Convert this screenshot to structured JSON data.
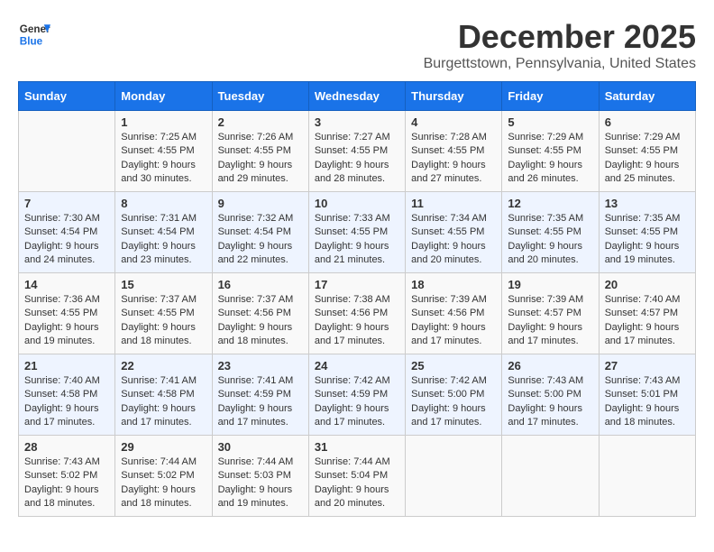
{
  "logo": {
    "line1": "General",
    "line2": "Blue"
  },
  "title": "December 2025",
  "subtitle": "Burgettstown, Pennsylvania, United States",
  "headers": [
    "Sunday",
    "Monday",
    "Tuesday",
    "Wednesday",
    "Thursday",
    "Friday",
    "Saturday"
  ],
  "weeks": [
    [
      {
        "day": "",
        "info": ""
      },
      {
        "day": "1",
        "info": "Sunrise: 7:25 AM\nSunset: 4:55 PM\nDaylight: 9 hours\nand 30 minutes."
      },
      {
        "day": "2",
        "info": "Sunrise: 7:26 AM\nSunset: 4:55 PM\nDaylight: 9 hours\nand 29 minutes."
      },
      {
        "day": "3",
        "info": "Sunrise: 7:27 AM\nSunset: 4:55 PM\nDaylight: 9 hours\nand 28 minutes."
      },
      {
        "day": "4",
        "info": "Sunrise: 7:28 AM\nSunset: 4:55 PM\nDaylight: 9 hours\nand 27 minutes."
      },
      {
        "day": "5",
        "info": "Sunrise: 7:29 AM\nSunset: 4:55 PM\nDaylight: 9 hours\nand 26 minutes."
      },
      {
        "day": "6",
        "info": "Sunrise: 7:29 AM\nSunset: 4:55 PM\nDaylight: 9 hours\nand 25 minutes."
      }
    ],
    [
      {
        "day": "7",
        "info": "Sunrise: 7:30 AM\nSunset: 4:54 PM\nDaylight: 9 hours\nand 24 minutes."
      },
      {
        "day": "8",
        "info": "Sunrise: 7:31 AM\nSunset: 4:54 PM\nDaylight: 9 hours\nand 23 minutes."
      },
      {
        "day": "9",
        "info": "Sunrise: 7:32 AM\nSunset: 4:54 PM\nDaylight: 9 hours\nand 22 minutes."
      },
      {
        "day": "10",
        "info": "Sunrise: 7:33 AM\nSunset: 4:55 PM\nDaylight: 9 hours\nand 21 minutes."
      },
      {
        "day": "11",
        "info": "Sunrise: 7:34 AM\nSunset: 4:55 PM\nDaylight: 9 hours\nand 20 minutes."
      },
      {
        "day": "12",
        "info": "Sunrise: 7:35 AM\nSunset: 4:55 PM\nDaylight: 9 hours\nand 20 minutes."
      },
      {
        "day": "13",
        "info": "Sunrise: 7:35 AM\nSunset: 4:55 PM\nDaylight: 9 hours\nand 19 minutes."
      }
    ],
    [
      {
        "day": "14",
        "info": "Sunrise: 7:36 AM\nSunset: 4:55 PM\nDaylight: 9 hours\nand 19 minutes."
      },
      {
        "day": "15",
        "info": "Sunrise: 7:37 AM\nSunset: 4:55 PM\nDaylight: 9 hours\nand 18 minutes."
      },
      {
        "day": "16",
        "info": "Sunrise: 7:37 AM\nSunset: 4:56 PM\nDaylight: 9 hours\nand 18 minutes."
      },
      {
        "day": "17",
        "info": "Sunrise: 7:38 AM\nSunset: 4:56 PM\nDaylight: 9 hours\nand 17 minutes."
      },
      {
        "day": "18",
        "info": "Sunrise: 7:39 AM\nSunset: 4:56 PM\nDaylight: 9 hours\nand 17 minutes."
      },
      {
        "day": "19",
        "info": "Sunrise: 7:39 AM\nSunset: 4:57 PM\nDaylight: 9 hours\nand 17 minutes."
      },
      {
        "day": "20",
        "info": "Sunrise: 7:40 AM\nSunset: 4:57 PM\nDaylight: 9 hours\nand 17 minutes."
      }
    ],
    [
      {
        "day": "21",
        "info": "Sunrise: 7:40 AM\nSunset: 4:58 PM\nDaylight: 9 hours\nand 17 minutes."
      },
      {
        "day": "22",
        "info": "Sunrise: 7:41 AM\nSunset: 4:58 PM\nDaylight: 9 hours\nand 17 minutes."
      },
      {
        "day": "23",
        "info": "Sunrise: 7:41 AM\nSunset: 4:59 PM\nDaylight: 9 hours\nand 17 minutes."
      },
      {
        "day": "24",
        "info": "Sunrise: 7:42 AM\nSunset: 4:59 PM\nDaylight: 9 hours\nand 17 minutes."
      },
      {
        "day": "25",
        "info": "Sunrise: 7:42 AM\nSunset: 5:00 PM\nDaylight: 9 hours\nand 17 minutes."
      },
      {
        "day": "26",
        "info": "Sunrise: 7:43 AM\nSunset: 5:00 PM\nDaylight: 9 hours\nand 17 minutes."
      },
      {
        "day": "27",
        "info": "Sunrise: 7:43 AM\nSunset: 5:01 PM\nDaylight: 9 hours\nand 18 minutes."
      }
    ],
    [
      {
        "day": "28",
        "info": "Sunrise: 7:43 AM\nSunset: 5:02 PM\nDaylight: 9 hours\nand 18 minutes."
      },
      {
        "day": "29",
        "info": "Sunrise: 7:44 AM\nSunset: 5:02 PM\nDaylight: 9 hours\nand 18 minutes."
      },
      {
        "day": "30",
        "info": "Sunrise: 7:44 AM\nSunset: 5:03 PM\nDaylight: 9 hours\nand 19 minutes."
      },
      {
        "day": "31",
        "info": "Sunrise: 7:44 AM\nSunset: 5:04 PM\nDaylight: 9 hours\nand 20 minutes."
      },
      {
        "day": "",
        "info": ""
      },
      {
        "day": "",
        "info": ""
      },
      {
        "day": "",
        "info": ""
      }
    ]
  ]
}
